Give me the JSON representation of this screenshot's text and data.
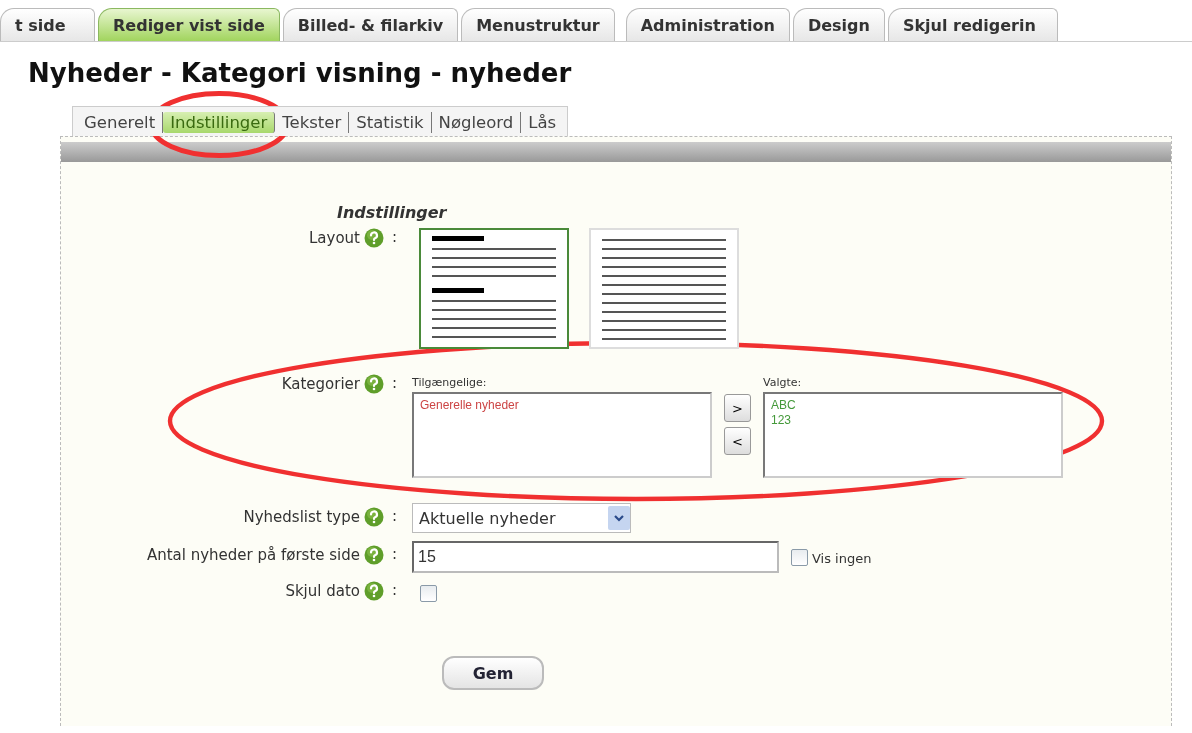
{
  "top_tabs": [
    {
      "label": "t side",
      "selected": false
    },
    {
      "label": "Rediger vist side",
      "selected": true
    },
    {
      "label": "Billed- & filarkiv",
      "selected": false
    },
    {
      "label": "Menustruktur",
      "selected": false
    },
    {
      "label": "Administration",
      "selected": false
    },
    {
      "label": "Design",
      "selected": false
    },
    {
      "label": "Skjul redigerin",
      "selected": false
    }
  ],
  "heading": "Nyheder - Kategori visning - nyheder",
  "sub_tabs": [
    {
      "label": "Generelt",
      "selected": false
    },
    {
      "label": "Indstillinger",
      "selected": true
    },
    {
      "label": "Tekster",
      "selected": false
    },
    {
      "label": "Statistik",
      "selected": false
    },
    {
      "label": "Nøgleord",
      "selected": false
    },
    {
      "label": "Lås",
      "selected": false
    }
  ],
  "form": {
    "title": "Indstillinger",
    "rows": [
      {
        "kind": "layout",
        "label": "Layout",
        "separator": ":",
        "options": [
          {
            "kind": "headlines",
            "selected": true
          },
          {
            "kind": "list",
            "selected": false
          }
        ]
      },
      {
        "kind": "categories",
        "label": "Kategorier",
        "separator": ":",
        "available_label": "Tilgængelige:",
        "available": [
          {
            "text": "Generelle nyheder",
            "color": "#cc4444"
          }
        ],
        "add_button": ">",
        "remove_button": "<",
        "selected_label": "Valgte:",
        "selected_items": [
          {
            "text": "ABC",
            "color": "#44993a"
          },
          {
            "text": "123",
            "color": "#44993a"
          }
        ]
      },
      {
        "kind": "select",
        "label": "Nyhedslist type",
        "separator": ":",
        "value": "Aktuelle nyheder"
      },
      {
        "kind": "text",
        "label": "Antal nyheder på første side",
        "separator": ":",
        "value": "15",
        "option_label": "Vis ingen",
        "option_checked": false
      },
      {
        "kind": "checkbox",
        "label": "Skjul dato",
        "separator": ":",
        "checked": false
      }
    ],
    "save_button": "Gem"
  },
  "annotations": [
    {
      "kind": "tab_ellipse"
    },
    {
      "kind": "row_ellipse"
    }
  ]
}
